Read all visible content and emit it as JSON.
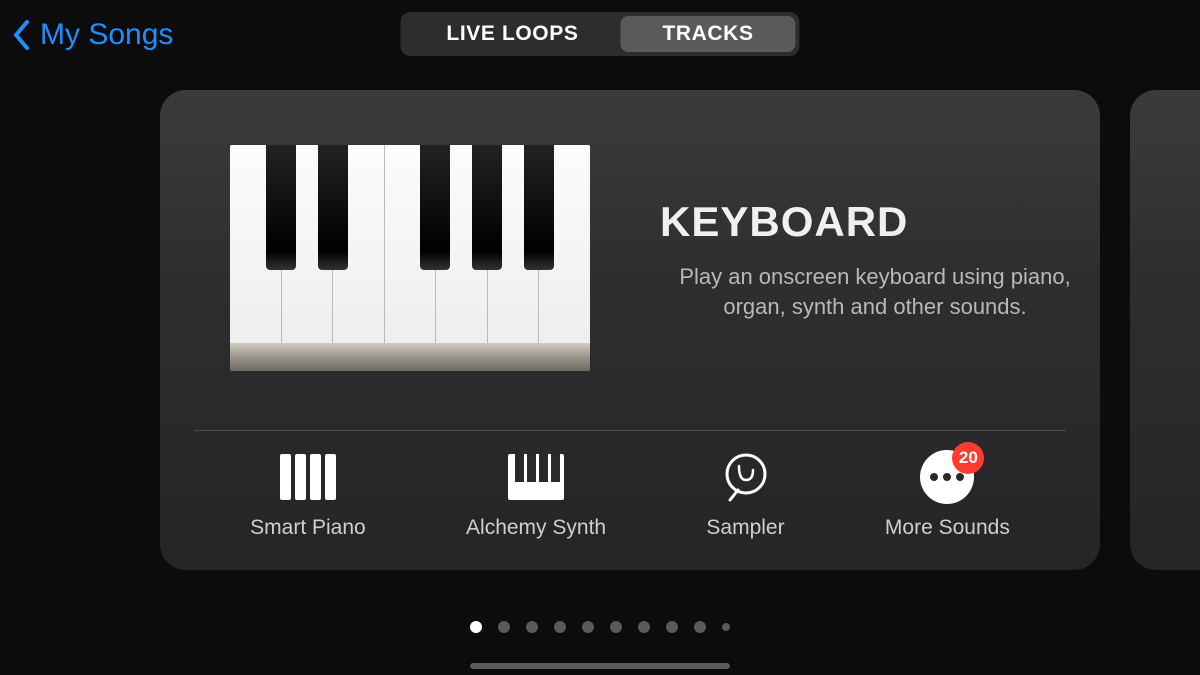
{
  "header": {
    "back_label": "My Songs",
    "segments": {
      "left": "LIVE LOOPS",
      "right": "TRACKS"
    },
    "active_segment": "TRACKS"
  },
  "card": {
    "title": "KEYBOARD",
    "description": "Play an onscreen keyboard using piano, organ, synth and other sounds.",
    "options": [
      {
        "label": "Smart Piano",
        "icon": "smart-piano-icon"
      },
      {
        "label": "Alchemy Synth",
        "icon": "alchemy-synth-icon"
      },
      {
        "label": "Sampler",
        "icon": "sampler-icon"
      },
      {
        "label": "More Sounds",
        "icon": "more-sounds-icon",
        "badge": "20"
      }
    ]
  },
  "pagination": {
    "page_count": 10,
    "active_index": 0
  },
  "colors": {
    "accent": "#1f8eff",
    "badge": "#ff3b30",
    "background": "#0c0c0c",
    "card": "#2e2e30"
  }
}
